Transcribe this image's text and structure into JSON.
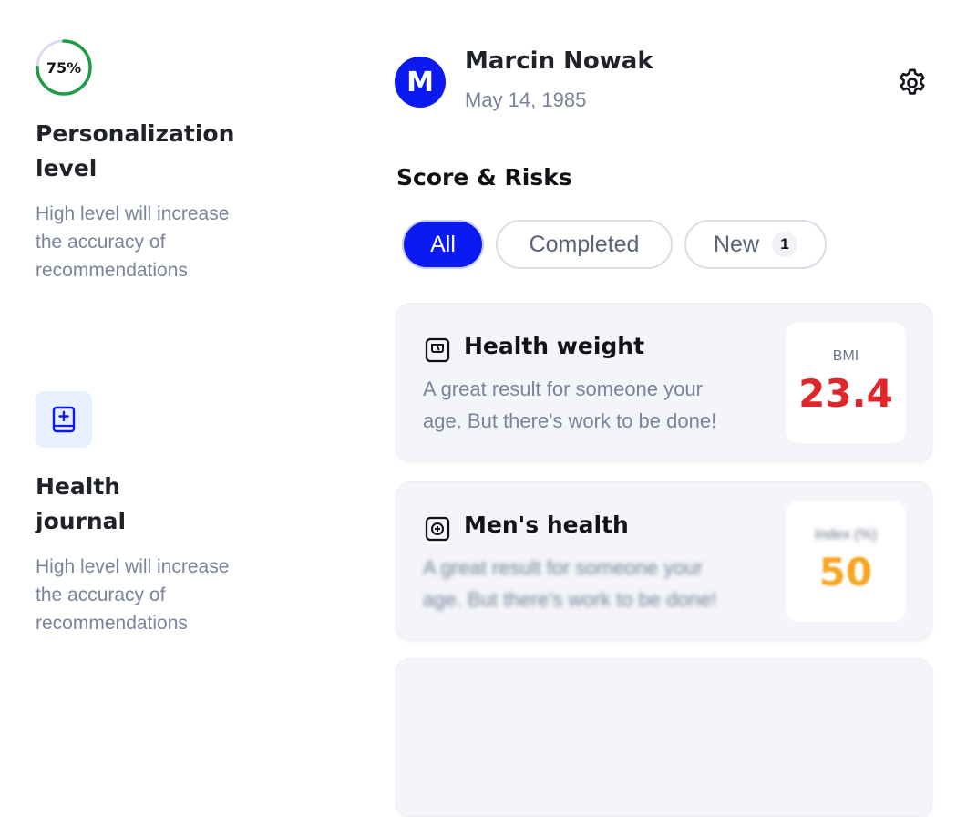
{
  "personalization": {
    "percent_label": "75%",
    "percent_value": 0.75,
    "title": "Personalization level",
    "title_line1": "Personalization",
    "title_line2": "level",
    "description_lines": [
      "High level will increase",
      "the accuracy of",
      "recommendations"
    ]
  },
  "journal": {
    "icon": "medical-book-icon",
    "title_line1": "Health",
    "title_line2": "journal",
    "description_lines": [
      "High level will increase",
      "the accuracy of",
      "recommendations"
    ]
  },
  "user": {
    "initial": "M",
    "name": "Marcin Nowak",
    "dob": "May 14, 1985"
  },
  "section_title": "Score & Risks",
  "filters": {
    "all": "All",
    "completed": "Completed",
    "new": "New",
    "new_count": "1"
  },
  "cards": [
    {
      "icon": "scale-icon",
      "title": "Health weight",
      "desc_line1": "A great result for someone your",
      "desc_line2": "age. But there's work to be done!",
      "metric_label": "BMI",
      "metric_value": "23.4",
      "metric_color": "#e0262b"
    },
    {
      "icon": "medical-box-icon",
      "title": "Men's health",
      "desc_line1": "A great result for someone your",
      "desc_line2": "age. But there's work to be done!",
      "metric_label": "Index (%)",
      "metric_value": "50",
      "metric_color": "#f5a623"
    }
  ],
  "colors": {
    "accent": "#0a1af0",
    "progress": "#1f9d45",
    "progress_track": "#d9dcf5",
    "muted_text": "#7a839c"
  }
}
